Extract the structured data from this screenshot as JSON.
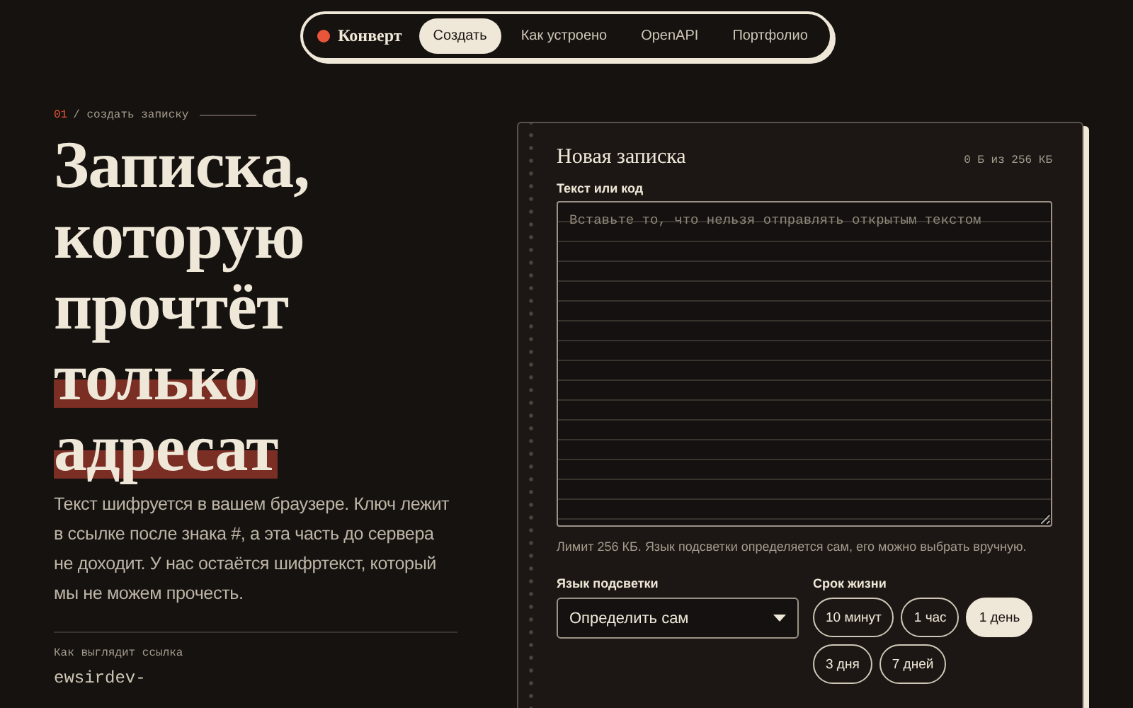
{
  "nav": {
    "brand": "Конверт",
    "items": [
      {
        "label": "Создать",
        "selected": true
      },
      {
        "label": "Как устроено",
        "selected": false
      },
      {
        "label": "OpenAPI",
        "selected": false
      },
      {
        "label": "Портфолио",
        "selected": false
      }
    ]
  },
  "hero": {
    "step_number": "01",
    "step_label": "/ создать записку",
    "heading": [
      {
        "text": "Записка,",
        "highlight": false
      },
      {
        "text": "которую",
        "highlight": false
      },
      {
        "text": "прочтёт",
        "highlight": false
      },
      {
        "text": "только",
        "highlight": true
      },
      {
        "text": "адресат",
        "highlight": true
      }
    ],
    "description": "Текст шифруется в вашем браузере. Ключ лежит в ссылке после знака #, а эта часть до сервера не доходит. У нас остаётся шифртекст, который мы не можем прочесть.",
    "link_preview_label": "Как выглядит ссылка",
    "link_preview": "ewsirdev-"
  },
  "card": {
    "title": "Новая записка",
    "counter": "0 Б из 256 КБ",
    "text_label": "Текст или код",
    "text_placeholder": "Вставьте то, что нельзя отправлять открытым текстом",
    "hint": "Лимит 256 КБ. Язык подсветки определяется сам, его можно выбрать вручную.",
    "language_label": "Язык подсветки",
    "language_value": "Определить сам",
    "lifetime_label": "Срок жизни",
    "lifetimes": [
      {
        "label": "10 минут",
        "selected": false
      },
      {
        "label": "1 час",
        "selected": false
      },
      {
        "label": "1 день",
        "selected": true
      },
      {
        "label": "3 дня",
        "selected": false
      },
      {
        "label": "7 дней",
        "selected": false
      }
    ]
  }
}
